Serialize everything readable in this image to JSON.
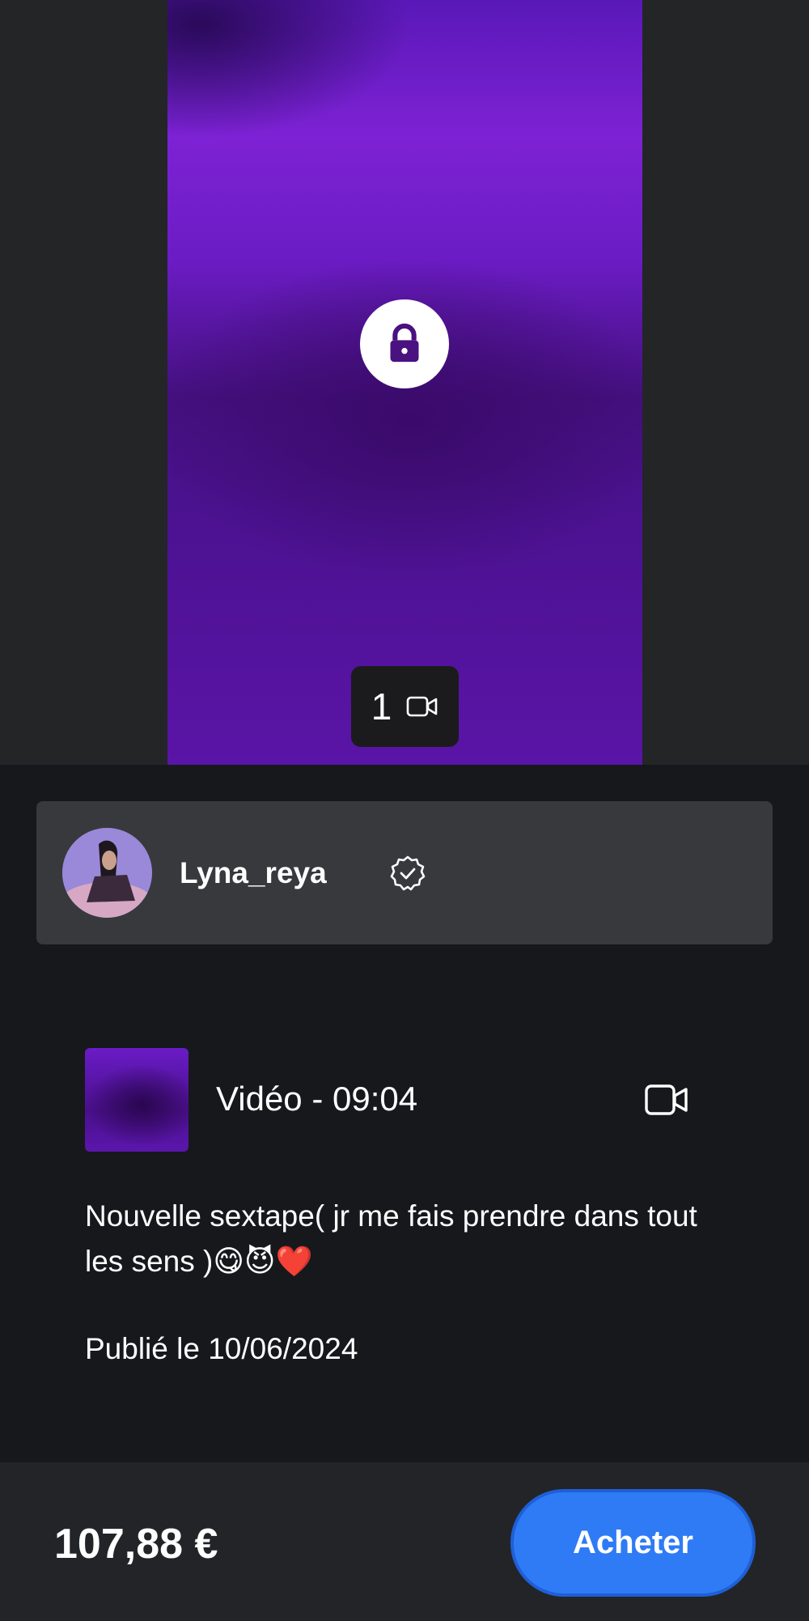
{
  "media": {
    "count": "1",
    "lock_icon": "lock-icon",
    "type_icon": "video-camera-icon"
  },
  "creator": {
    "username": "Lyna_reya",
    "verified_icon": "verified-badge-icon"
  },
  "post": {
    "media_label": "Vidéo - 09:04",
    "type_icon": "video-camera-icon",
    "description": "Nouvelle sextape( jr me fais prendre dans tout les sens )😋😈❤️",
    "published": "Publié le 10/06/2024"
  },
  "footer": {
    "price": "107,88 €",
    "buy_label": "Acheter"
  },
  "colors": {
    "accent": "#2f7bf6",
    "preview_purple": "#7d22d4",
    "background": "#17181c"
  }
}
